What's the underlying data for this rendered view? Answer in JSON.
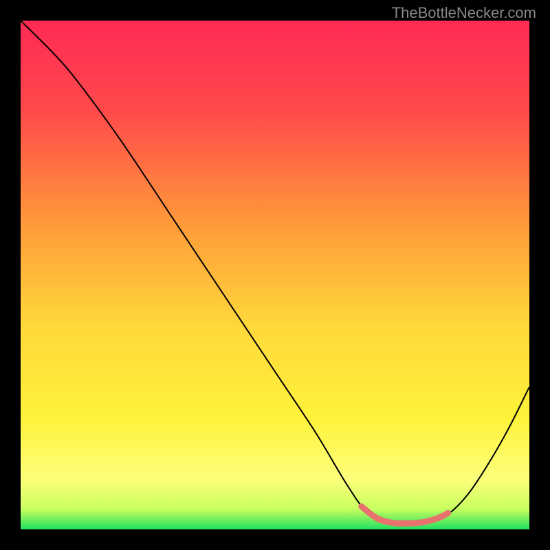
{
  "watermark": "TheBottleNecker.com",
  "chart_data": {
    "type": "line",
    "title": "",
    "xlabel": "",
    "ylabel": "",
    "xlim": [
      0,
      100
    ],
    "ylim": [
      0,
      100
    ],
    "background_gradient": {
      "stops": [
        {
          "offset": 0,
          "color": "#ff2a55"
        },
        {
          "offset": 18,
          "color": "#ff4a4a"
        },
        {
          "offset": 40,
          "color": "#ff9a3a"
        },
        {
          "offset": 60,
          "color": "#ffd83a"
        },
        {
          "offset": 78,
          "color": "#fff23a"
        },
        {
          "offset": 90,
          "color": "#fdff7a"
        },
        {
          "offset": 96,
          "color": "#c8ff60"
        },
        {
          "offset": 100,
          "color": "#20e060"
        }
      ]
    },
    "series": [
      {
        "name": "curve",
        "color": "#000000",
        "width": 2,
        "points": [
          {
            "x": 0,
            "y": 100
          },
          {
            "x": 7,
            "y": 93
          },
          {
            "x": 12,
            "y": 87
          },
          {
            "x": 20,
            "y": 76
          },
          {
            "x": 30,
            "y": 61
          },
          {
            "x": 40,
            "y": 46
          },
          {
            "x": 50,
            "y": 31
          },
          {
            "x": 58,
            "y": 19
          },
          {
            "x": 64,
            "y": 9
          },
          {
            "x": 68,
            "y": 3.5
          },
          {
            "x": 72,
            "y": 1.5
          },
          {
            "x": 76,
            "y": 1.2
          },
          {
            "x": 80,
            "y": 1.5
          },
          {
            "x": 84,
            "y": 3
          },
          {
            "x": 88,
            "y": 7
          },
          {
            "x": 92,
            "y": 13
          },
          {
            "x": 96,
            "y": 20
          },
          {
            "x": 100,
            "y": 28
          }
        ]
      },
      {
        "name": "marker-range",
        "color": "#e8736e",
        "width": 9,
        "points": [
          {
            "x": 67,
            "y": 4.5
          },
          {
            "x": 70,
            "y": 2.2
          },
          {
            "x": 73,
            "y": 1.3
          },
          {
            "x": 76,
            "y": 1.2
          },
          {
            "x": 79,
            "y": 1.4
          },
          {
            "x": 82,
            "y": 2.2
          },
          {
            "x": 84,
            "y": 3.2
          }
        ]
      }
    ]
  }
}
